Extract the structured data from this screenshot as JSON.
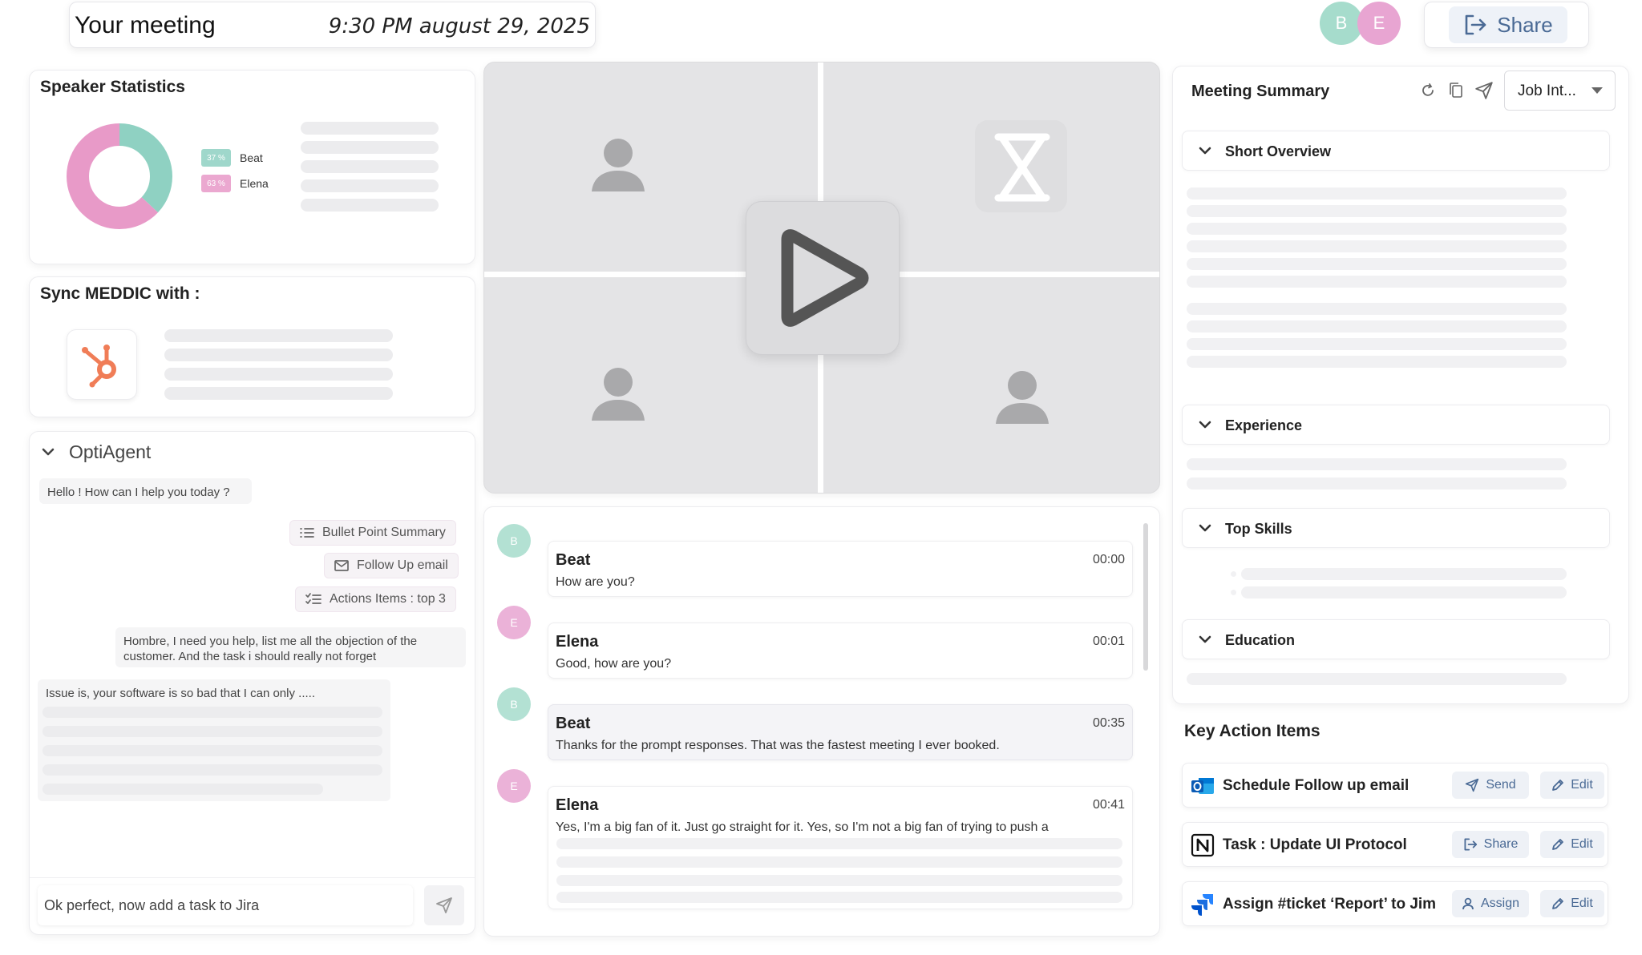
{
  "header": {
    "title": "Your meeting",
    "datetime": "9:30 PM august 29, 2025",
    "participants": [
      {
        "initial": "B",
        "color": "#a6dccc"
      },
      {
        "initial": "E",
        "color": "#e8a5d2"
      }
    ],
    "share_label": "Share"
  },
  "speaker_stats": {
    "title": "Speaker Statistics",
    "speakers": [
      {
        "name": "Beat",
        "percent_label": "37 %",
        "color": "#8fd1c2"
      },
      {
        "name": "Elena",
        "percent_label": "63 %",
        "color": "#e89ac8"
      }
    ]
  },
  "chart_data": {
    "type": "pie",
    "categories": [
      "Beat",
      "Elena"
    ],
    "values": [
      37,
      63
    ],
    "colors": [
      "#8fd1c2",
      "#e89ac8"
    ],
    "title": "",
    "legend": "right"
  },
  "sync": {
    "title": "Sync MEDDIC with :",
    "app_icon": "hubspot-icon"
  },
  "agent": {
    "title": "OptiAgent",
    "greeting": "Hello ! How can I help you today ?",
    "suggestions": [
      {
        "label": "Bullet Point Summary",
        "icon": "list-icon"
      },
      {
        "label": "Follow Up email",
        "icon": "mail-icon"
      },
      {
        "label": "Actions Items : top 3",
        "icon": "checklist-icon"
      }
    ],
    "user_message": "Hombre, I need you help, list me all the objection of the customer. And the task i should really not forget",
    "reply_start": "Issue is, your software is so bad that I can only .....",
    "input_value": "Ok perfect, now add a task to Jira"
  },
  "transcript": [
    {
      "speaker": "Beat",
      "initial": "B",
      "color": "#a6dccc",
      "time": "00:00",
      "text": "How are you?"
    },
    {
      "speaker": "Elena",
      "initial": "E",
      "color": "#e8a5d2",
      "time": "00:01",
      "text": "Good, how are you?"
    },
    {
      "speaker": "Beat",
      "initial": "B",
      "color": "#a6dccc",
      "time": "00:35",
      "text": "Thanks for the prompt responses. That was the fastest meeting I ever booked."
    },
    {
      "speaker": "Elena",
      "initial": "E",
      "color": "#e8a5d2",
      "time": "00:41",
      "text": "Yes, I'm a big fan of it. Just go straight for it. Yes, so I'm not a big fan of trying to push a"
    }
  ],
  "summary": {
    "title": "Meeting Summary",
    "template": "Job Int...",
    "sections": [
      "Short Overview",
      "Experience",
      "Top Skills",
      "Education"
    ]
  },
  "actions": {
    "title": "Key Action Items",
    "items": [
      {
        "label": "Schedule Follow up email",
        "app_icon": "outlook-icon",
        "primary": "Send",
        "secondary": "Edit"
      },
      {
        "label": "Task : Update UI Protocol",
        "app_icon": "notion-icon",
        "primary": "Share",
        "secondary": "Edit"
      },
      {
        "label": "Assign #ticket ‘Report’ to Jim",
        "app_icon": "jira-icon",
        "primary": "Assign",
        "secondary": "Edit"
      }
    ]
  }
}
